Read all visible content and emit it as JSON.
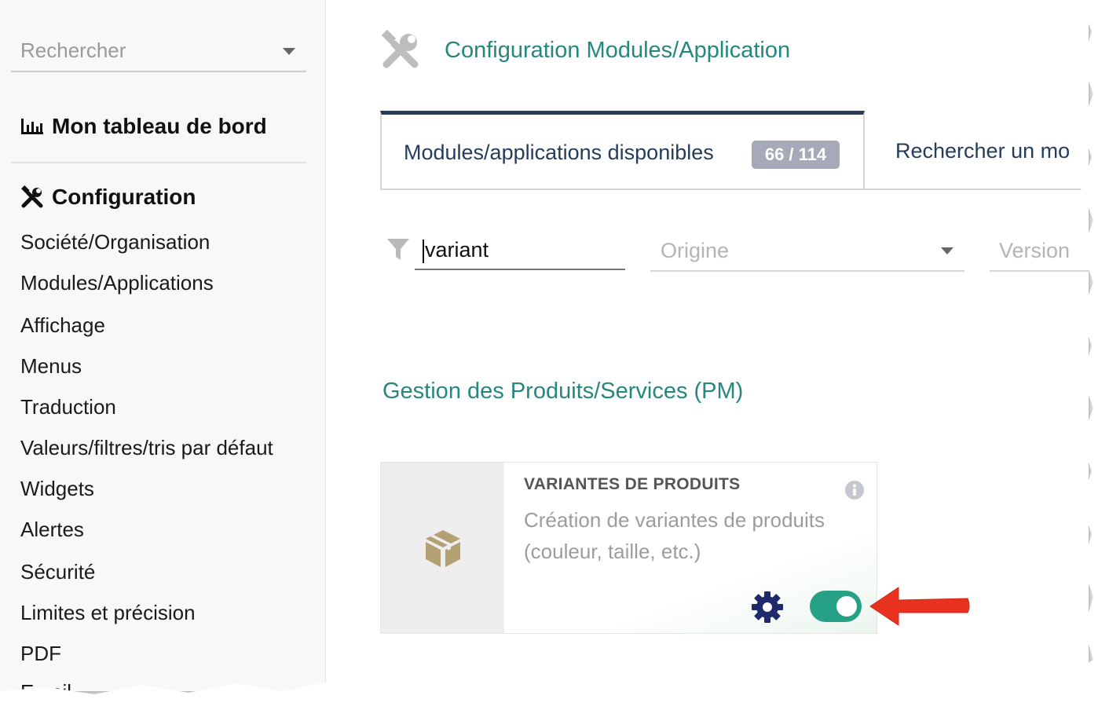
{
  "sidebar": {
    "search_placeholder": "Rechercher",
    "dashboard_label": "Mon tableau de bord",
    "config_label": "Configuration",
    "items": [
      {
        "label": "Société/Organisation"
      },
      {
        "label": "Modules/Applications"
      },
      {
        "label": "Affichage"
      },
      {
        "label": "Menus"
      },
      {
        "label": "Traduction"
      },
      {
        "label": "Valeurs/filtres/tris par défaut"
      },
      {
        "label": "Widgets"
      },
      {
        "label": "Alertes"
      },
      {
        "label": "Sécurité"
      },
      {
        "label": "Limites et précision"
      },
      {
        "label": "PDF"
      },
      {
        "label": "Email"
      }
    ]
  },
  "header": {
    "title": "Configuration Modules/Application"
  },
  "tabs": {
    "available_label": "Modules/applications disponibles",
    "available_count": "66 / 114",
    "search_label": "Rechercher un mo"
  },
  "filters": {
    "search_value": "variant",
    "origin_placeholder": "Origine",
    "version_placeholder": "Version"
  },
  "section": {
    "title": "Gestion des Produits/Services (PM)"
  },
  "module_card": {
    "title": "VARIANTES DE PRODUITS",
    "description": "Création de variantes de produits (couleur, taille, etc.)",
    "enabled": true
  },
  "colors": {
    "accent_teal": "#25877d",
    "tab_text": "#263c5c",
    "toggle_on": "#27a185",
    "arrow": "#e8321f",
    "box_icon": "#b3a173"
  },
  "icons": [
    "chart-bar-icon",
    "tools-icon",
    "filter-icon",
    "box-icon",
    "info-icon",
    "gear-icon",
    "toggle-icon",
    "arrow-left-icon"
  ]
}
